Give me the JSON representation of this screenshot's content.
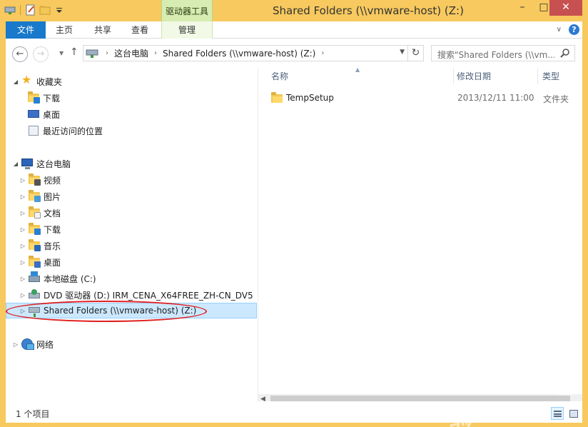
{
  "window": {
    "title": "Shared Folders (\\\\vmware-host) (Z:)",
    "contextual_tab_group": "驱动器工具",
    "minimize": "–",
    "maximize": "□",
    "close": "✕",
    "accent": "#f7c95e"
  },
  "ribbon": {
    "tabs": [
      {
        "label": "文件"
      },
      {
        "label": "主页"
      },
      {
        "label": "共享"
      },
      {
        "label": "查看"
      },
      {
        "label": "管理"
      }
    ],
    "help": "?"
  },
  "address": {
    "segments": [
      "这台电脑",
      "Shared Folders (\\\\vmware-host) (Z:)"
    ]
  },
  "search": {
    "placeholder": "搜索\"Shared Folders (\\\\vm..."
  },
  "nav_pane": {
    "favorites": {
      "label": "收藏夹",
      "items": [
        {
          "label": "下载",
          "icon": "download-folder-icon"
        },
        {
          "label": "桌面",
          "icon": "desktop-icon"
        },
        {
          "label": "最近访问的位置",
          "icon": "recent-places-icon"
        }
      ]
    },
    "this_pc": {
      "label": "这台电脑",
      "items": [
        {
          "label": "视频",
          "icon": "videos-folder-icon"
        },
        {
          "label": "图片",
          "icon": "pictures-folder-icon"
        },
        {
          "label": "文档",
          "icon": "documents-folder-icon"
        },
        {
          "label": "下载",
          "icon": "download-folder-icon"
        },
        {
          "label": "音乐",
          "icon": "music-folder-icon"
        },
        {
          "label": "桌面",
          "icon": "desktop-folder-icon"
        },
        {
          "label": "本地磁盘 (C:)",
          "icon": "local-disk-icon"
        },
        {
          "label": "DVD 驱动器 (D:) IRM_CENA_X64FREE_ZH-CN_DV5",
          "icon": "dvd-drive-icon"
        },
        {
          "label": "Shared Folders (\\\\vmware-host) (Z:)",
          "icon": "network-drive-icon",
          "selected": true
        }
      ]
    },
    "network": {
      "label": "网络"
    }
  },
  "content": {
    "columns": [
      "名称",
      "修改日期",
      "类型"
    ],
    "rows": [
      {
        "name": "TempSetup",
        "modified": "2013/12/11 11:00",
        "type": "文件夹"
      }
    ]
  },
  "status": {
    "item_count": "1 个项目"
  },
  "watermark": {
    "main": "Bai du 经验",
    "sub": "jingyan.baidu.com"
  }
}
